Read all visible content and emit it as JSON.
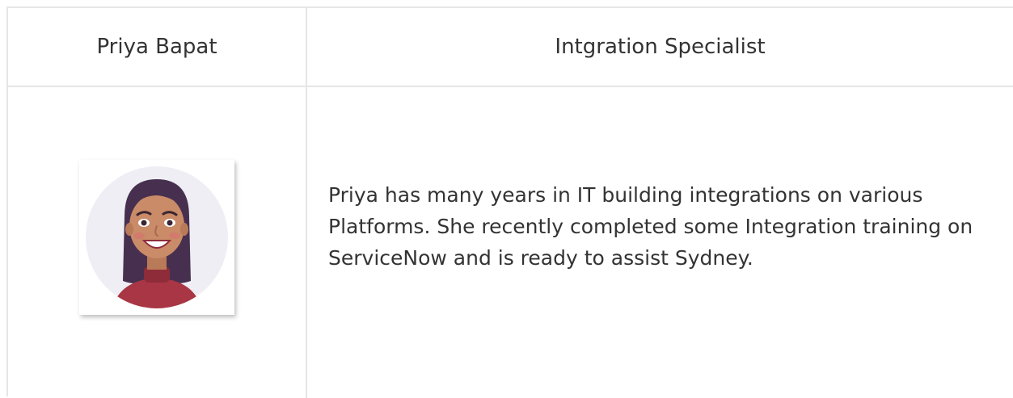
{
  "persona": {
    "name": "Priya Bapat",
    "role": "Intgration Specialist",
    "bio": "Priya has many years in IT building integrations on various Platforms. She recently completed some Integration training on ServiceNow and is ready to assist Sydney."
  },
  "colors": {
    "border": "#e6e6e6",
    "text": "#333333",
    "avatar_bg": "#eeeef4",
    "sweater": "#a83644",
    "hair": "#47304f",
    "skin": "#c98b68"
  },
  "icons": {
    "avatar": "woman-avatar-illustration"
  }
}
